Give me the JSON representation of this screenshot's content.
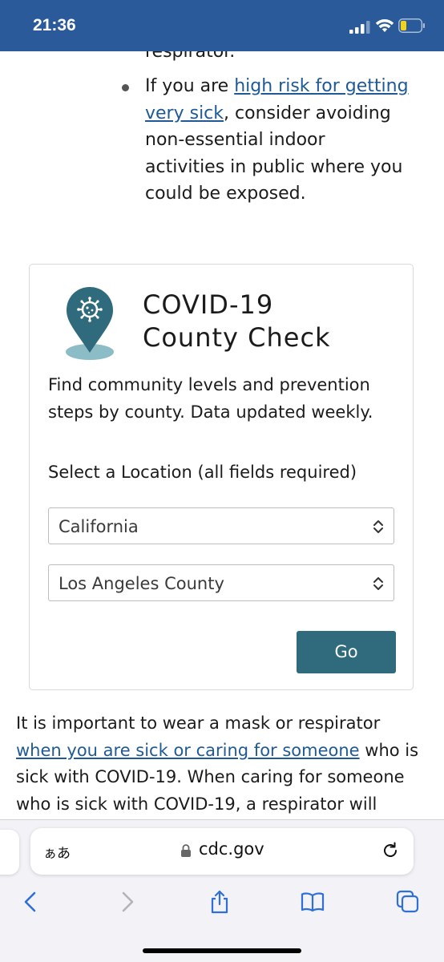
{
  "status_bar": {
    "time": "21:36"
  },
  "article": {
    "cut_off_text": "respirator.",
    "bullet": {
      "prefix": "If you are ",
      "link": "high risk for getting very sick",
      "suffix": ", consider avoiding non-essential indoor activities in public where you could be exposed."
    },
    "paragraph": {
      "prefix": "It is important to wear a mask or respirator ",
      "link": "when you are sick or caring for someone",
      "suffix": " who is sick with COVID-19. When caring for someone who is sick with COVID-19, a respirator will"
    }
  },
  "county_check": {
    "title_line1": "COVID-19",
    "title_line2": "County Check",
    "description": "Find community levels and prevention steps by county. Data updated weekly.",
    "select_label": "Select a Location (all fields required)",
    "state_value": "California",
    "county_value": "Los Angeles County",
    "go_label": "Go",
    "accent_color": "#2f6b7d"
  },
  "browser": {
    "aa_label": "ぁあ",
    "url": "cdc.gov"
  },
  "colors": {
    "status_bar": "#2a5a9a",
    "link": "#1f5a96",
    "toolbar_icon": "#2f6fd6"
  }
}
